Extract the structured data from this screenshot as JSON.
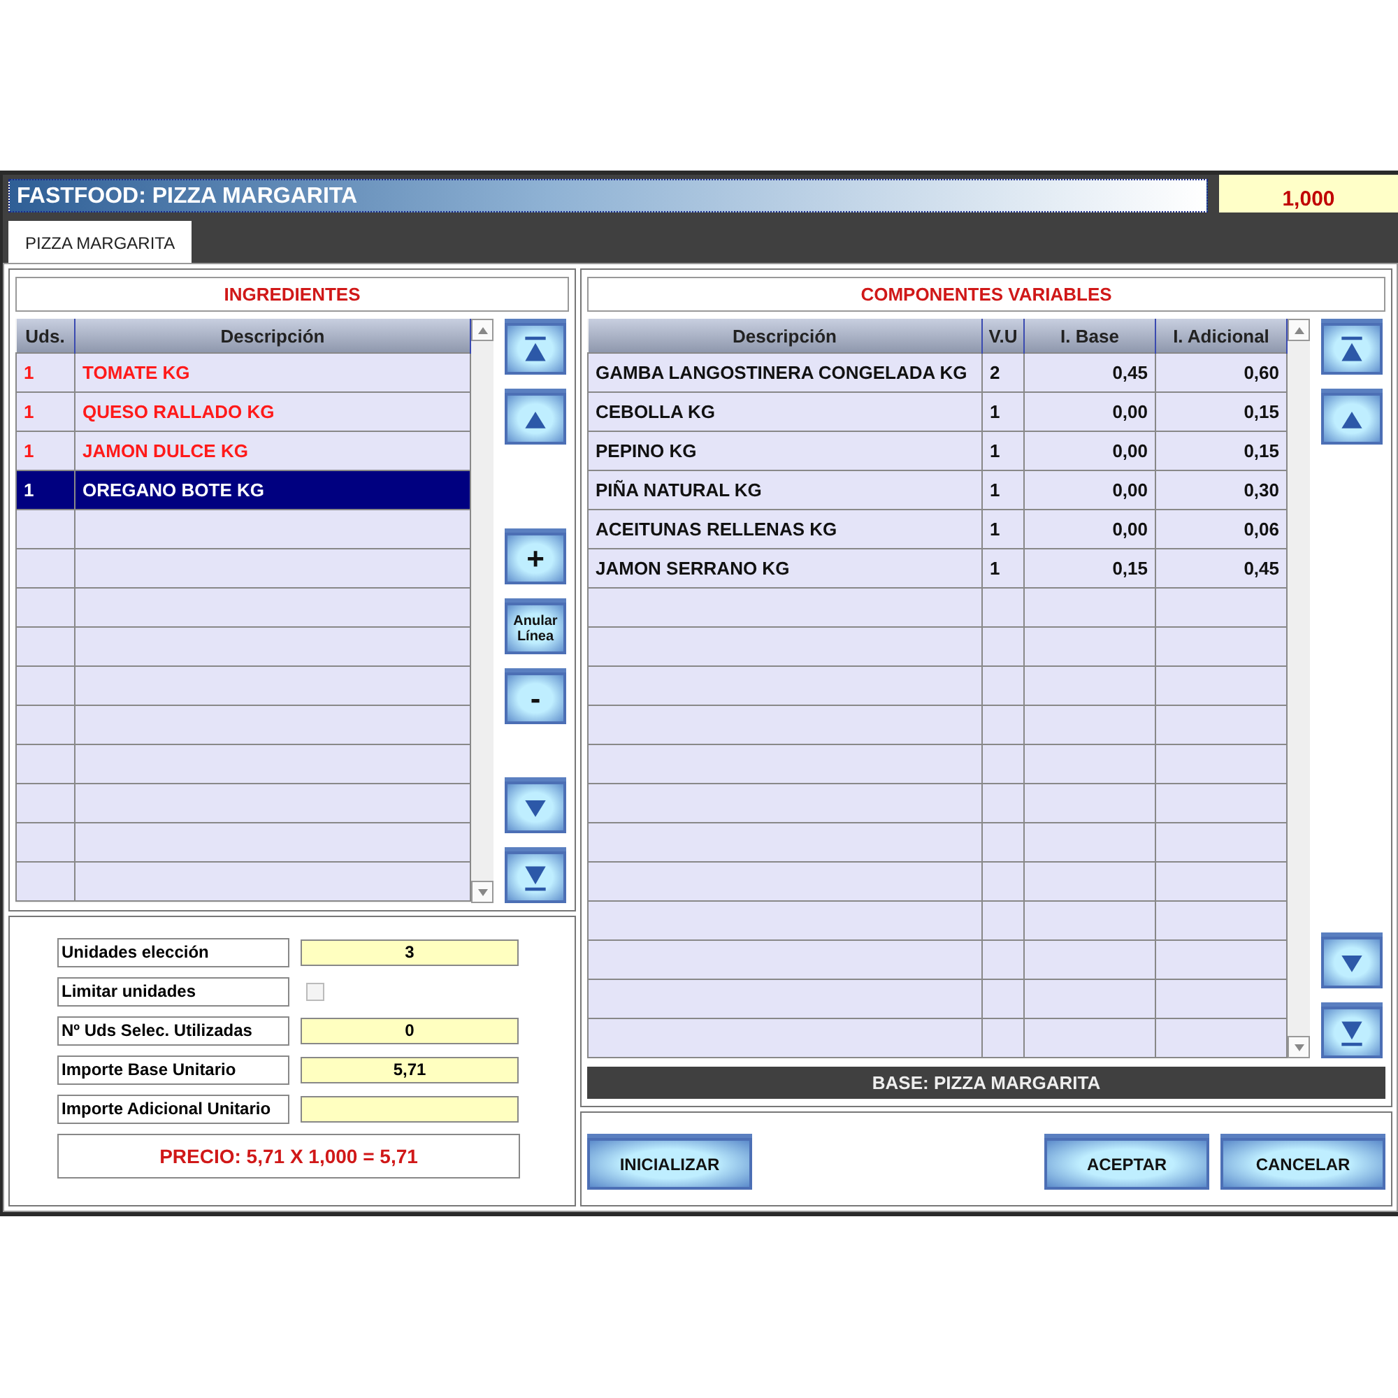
{
  "window": {
    "title": "FASTFOOD: PIZZA MARGARITA",
    "units": "1,000"
  },
  "tabs": [
    {
      "label": "PIZZA MARGARITA",
      "selected": true
    }
  ],
  "ingredients": {
    "title": "INGREDIENTES",
    "columns": [
      "Uds.",
      "Descripción"
    ],
    "rows": [
      {
        "units": "1",
        "description": "TOMATE KG",
        "marked": true,
        "selected": false
      },
      {
        "units": "1",
        "description": "QUESO RALLADO KG",
        "marked": true,
        "selected": false
      },
      {
        "units": "1",
        "description": "JAMON DULCE KG",
        "marked": true,
        "selected": false
      },
      {
        "units": "1",
        "description": "OREGANO BOTE KG",
        "marked": false,
        "selected": true
      }
    ],
    "buttons": [
      {
        "kind": "first"
      },
      {
        "kind": "up"
      },
      {
        "kind": "plus",
        "label": "+"
      },
      {
        "kind": "text",
        "label": "Anular Línea"
      },
      {
        "kind": "minus",
        "label": "-"
      },
      {
        "kind": "down"
      },
      {
        "kind": "last"
      }
    ]
  },
  "form": {
    "fields": [
      {
        "label": "Unidades elección",
        "kind": "input",
        "value": "3"
      },
      {
        "label": "Limitar unidades",
        "kind": "checkbox",
        "checked": false
      },
      {
        "label": "Nº Uds Selec. Utilizadas",
        "kind": "input",
        "value": "0"
      },
      {
        "label": "Importe Base Unitario",
        "kind": "input",
        "value": "5,71"
      },
      {
        "label": "Importe Adicional Unitario",
        "kind": "input"
      }
    ],
    "price": "PRECIO: 5,71 X 1,000 = 5,71"
  },
  "components": {
    "title": "COMPONENTES VARIABLES",
    "columns": [
      "Descripción",
      "V.U",
      "I. Base",
      "I. Adicional"
    ],
    "rows": [
      {
        "description": "GAMBA LANGOSTINERA CONGELADA KG",
        "vu": "2",
        "base": "0,45",
        "extra": "0,60"
      },
      {
        "description": "CEBOLLA KG",
        "vu": "1",
        "base": "0,00",
        "extra": "0,15"
      },
      {
        "description": "PEPINO KG",
        "vu": "1",
        "base": "0,00",
        "extra": "0,15"
      },
      {
        "description": "PIÑA NATURAL KG",
        "vu": "1",
        "base": "0,00",
        "extra": "0,30"
      },
      {
        "description": "ACEITUNAS RELLENAS KG",
        "vu": "1",
        "base": "0,00",
        "extra": "0,06"
      },
      {
        "description": "JAMON SERRANO KG",
        "vu": "1",
        "base": "0,15",
        "extra": "0,45"
      }
    ],
    "buttons": [
      {
        "kind": "first"
      },
      {
        "kind": "up"
      },
      {
        "kind": "down"
      },
      {
        "kind": "last"
      }
    ],
    "base_label": "BASE: PIZZA MARGARITA"
  },
  "actions": [
    {
      "label": "INICIALIZAR"
    },
    {
      "label": "ACEPTAR"
    },
    {
      "label": "CANCELAR"
    }
  ]
}
